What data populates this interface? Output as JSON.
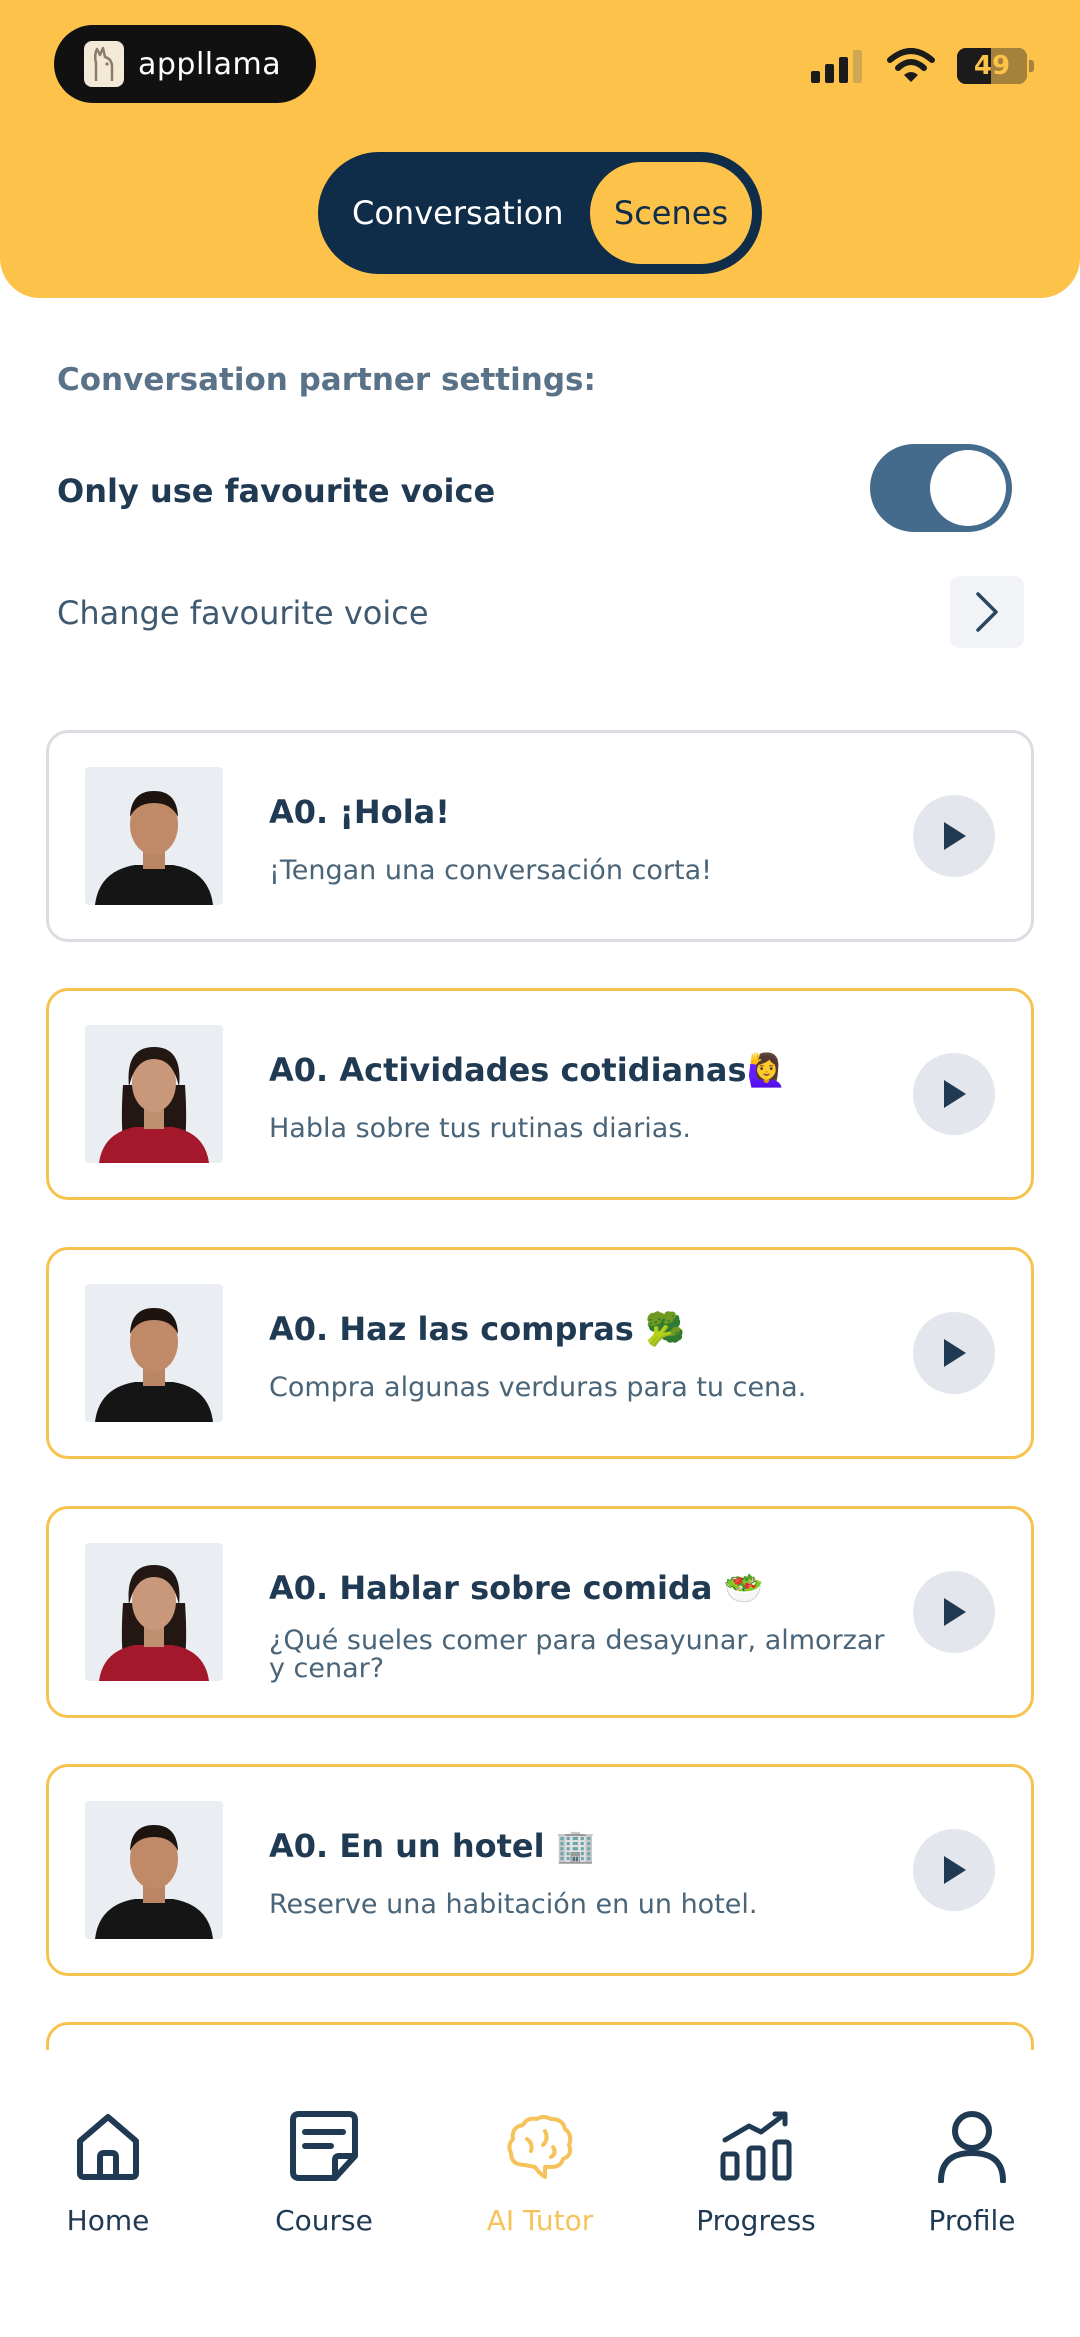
{
  "status_bar": {
    "app_name": "appllama",
    "battery": "49"
  },
  "segmented": {
    "left": "Conversation",
    "right": "Scenes"
  },
  "settings": {
    "title": "Conversation partner settings:",
    "only_fav_label": "Only use favourite voice",
    "toggle_on": true,
    "change_label": "Change favourite voice"
  },
  "scenes": [
    {
      "title": "A0. ¡Hola!",
      "subtitle": "¡Tengan una conversación corta!",
      "avatar": "male"
    },
    {
      "title": "A0. Actividades cotidianas🙋‍♀️",
      "subtitle": "Habla sobre tus rutinas diarias.",
      "avatar": "female"
    },
    {
      "title": "A0. Haz las compras 🥦",
      "subtitle": "Compra algunas verduras para tu cena.",
      "avatar": "male"
    },
    {
      "title": "A0. Hablar sobre comida 🥗",
      "subtitle": "¿Qué sueles comer para desayunar, almorzar y cenar?",
      "avatar": "female"
    },
    {
      "title": "A0. En un hotel 🏢",
      "subtitle": "Reserve una habitación en un hotel.",
      "avatar": "male"
    }
  ],
  "nav": [
    {
      "label": "Home",
      "icon": "home-icon"
    },
    {
      "label": "Course",
      "icon": "course-icon"
    },
    {
      "label": "AI Tutor",
      "icon": "brain-icon",
      "active": true
    },
    {
      "label": "Progress",
      "icon": "chart-icon"
    },
    {
      "label": "Profile",
      "icon": "profile-icon"
    }
  ],
  "colors": {
    "header": "#fdc24a",
    "navy": "#0f2d48",
    "accent_border": "#f7c34f"
  }
}
